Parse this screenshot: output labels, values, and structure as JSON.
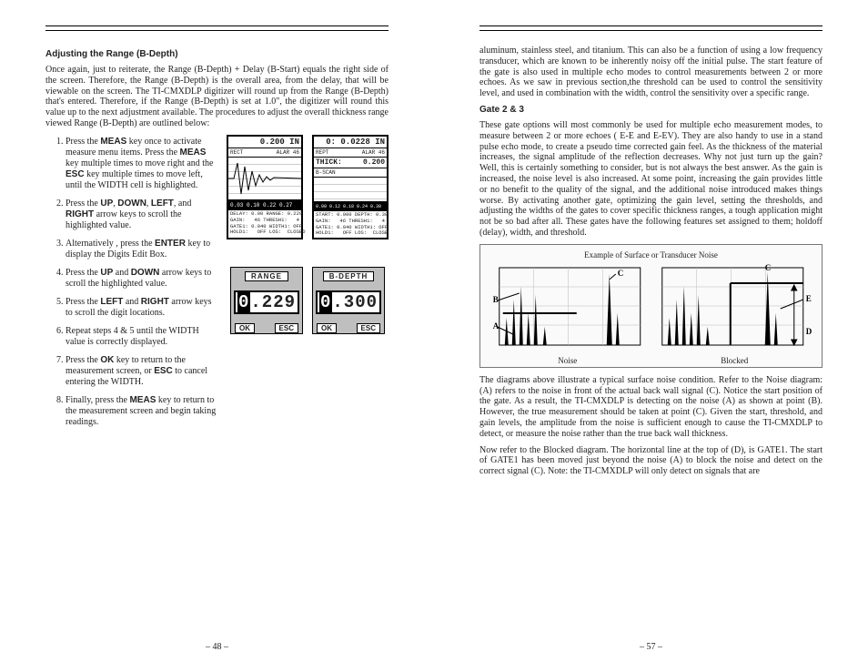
{
  "left": {
    "pageNumber": "– 48 –",
    "heading": "Adjusting the Range (B-Depth)",
    "intro": "Once again, just to reiterate, the Range (B-Depth) + Delay (B-Start) equals the right side of the screen. Therefore, the Range (B-Depth) is the overall area, from the delay, that will be viewable on the screen. The TI-CMXDLP digitizer will round  up from the Range (B-Depth) that's entered. Therefore, if the Range (B-Depth) is set at 1.0\", the digitizer will round this value up to the next adjustment available. The procedures to adjust the overall thickness range viewed Range (B-Depth) are outlined below:",
    "steps": [
      "Press the MEAS key once to activate measure menu items. Press the MEAS key multiple times to move right and the ESC key multiple times to move left, until the WIDTH cell is highlighted.",
      "Press the UP, DOWN, LEFT, and RIGHT arrow keys to scroll the highlighted value.",
      "Alternatively , press the ENTER key to display the Digits Edit Box.",
      "Press the UP and DOWN arrow keys to scroll the highlighted value.",
      "Press the LEFT and RIGHT arrow keys to scroll the digit locations.",
      "Repeat steps 4 & 5 until the WIDTH value is correctly displayed.",
      "Press the OK key to return to the measurement screen, or ESC to cancel entering the WIDTH.",
      "Finally, press the MEAS key to return to the measurement screen and begin taking readings."
    ],
    "keys": {
      "MEAS": "MEAS",
      "ESC": "ESC",
      "UP": "UP",
      "DOWN": "DOWN",
      "LEFT": "LEFT",
      "RIGHT": "RIGHT",
      "ENTER": "ENTER",
      "OK": "OK"
    },
    "lcdA": {
      "topValue": "0.200 IN",
      "bar1_l": "RECT",
      "bar1_r": "ALAR   46",
      "ticks": "0.03  0.10  0.22  0.27",
      "foot": "DELAY: 0.00 RANGE: 0.229\nGAIN:   46 THRESH1:   4\nGATE1: 0.040 WIDTH1: OFF\nHOLD1:   OFF LOS:  CLOSED"
    },
    "lcdB": {
      "topValue": "0: 0.0228 IN",
      "bar1_l": "REPT",
      "bar1_r": "ALAR   46",
      "thicklabel": "THICK:",
      "thickval": "0.200",
      "bscanlabel": "B-SCAN",
      "ticks": "0.00  0.12  0.18  0.24  0.30",
      "foot": "START: 0.000 DEPTH: 0.300\nGAIN:   46 THRESH1:   4\nGATE1: 0.040 WIDTH1: OFF\nHOLD1:   OFF LOS:  CLOSED"
    },
    "editA": {
      "label": "RANGE",
      "digits_hi": "0",
      "digits_rest": ".229",
      "ok": "OK",
      "esc": "ESC"
    },
    "editB": {
      "label": "B-DEPTH",
      "digits_hi": "0",
      "digits_rest": ".300",
      "ok": "OK",
      "esc": "ESC"
    }
  },
  "right": {
    "pageNumber": "– 57 –",
    "para1": "aluminum, stainless steel, and titanium. This can also be a function of using a low frequency transducer, which are known to be inherently noisy off the initial pulse. The start feature of the gate is also used in multiple echo modes to control measurements between 2 or more echoes. As we saw in previous section,the threshold can be used to control the sensitivity level, and used in combination with the width, control the sensitivity over a specific range.",
    "heading": "Gate 2 & 3",
    "para2": "These gate options will most commonly be used for multiple echo measurement modes, to measure between 2 or more echoes ( E-E and E-EV). They are also handy to use in a stand pulse echo mode, to create a pseudo time corrected gain feel. As the thickness of the material increases, the signal amplitude of the reflection decreases. Why not just turn up the gain? Well, this is certainly something to consider, but is not always the best answer. As the gain is increased, the noise level is also increased. At some point, increasing the gain provides little or no benefit to the quality of the signal, and the additional noise introduced makes things worse. By activating another gate, optimizing the gain level, setting the thresholds, and adjusting the widths of the gates to cover specific thickness ranges, a tough application might not be so bad after all. These gates have the following features set assigned to them; holdoff (delay), width, and threshold.",
    "diagTitle": "Example of Surface or Transducer Noise",
    "capNoise": "Noise",
    "capBlocked": "Blocked",
    "labels": {
      "A": "A",
      "B": "B",
      "C": "C",
      "D": "D",
      "E": "E"
    },
    "para3": "The diagrams above illustrate a typical surface noise condition. Refer to the Noise diagram: (A) refers to the noise in front of the actual back wall signal (C). Notice the start position of the gate. As a result, the TI-CMXDLP is detecting on the noise (A) as shown at point (B). However, the true measurement should be taken at point (C). Given the start, threshold, and gain levels, the amplitude from the noise is sufficient enough to cause the TI-CMXDLP to detect, or measure the noise rather than the true back wall thickness.",
    "para4": "Now refer to the Blocked diagram. The horizontal line at the top of (D), is GATE1. The start of GATE1 has been moved just beyond the noise (A) to block the noise and detect on the correct signal (C). Note: the TI-CMXDLP will only detect on signals that are"
  }
}
